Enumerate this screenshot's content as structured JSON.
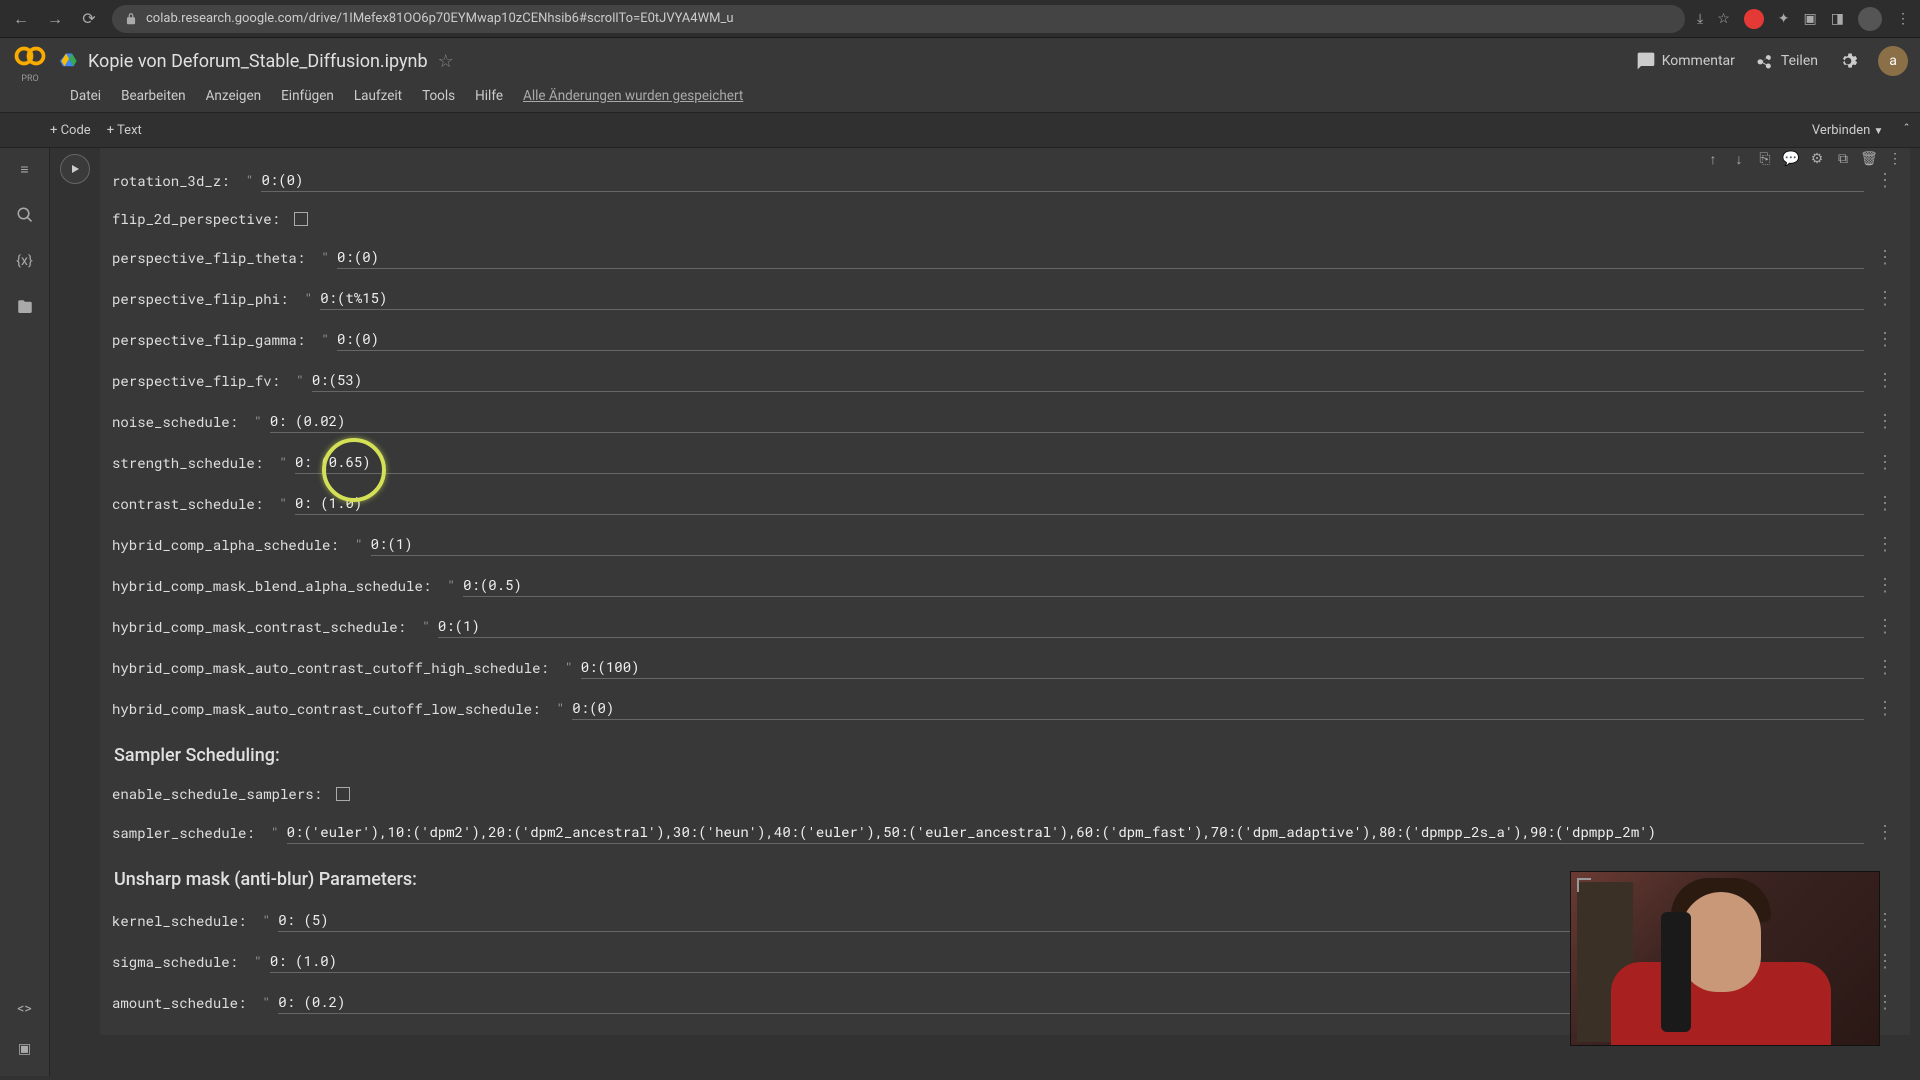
{
  "browser": {
    "url": "colab.research.google.com/drive/1IMefex81OO6p70EYMwap10zCENhsib6#scrollTo=E0tJVYA4WM_u"
  },
  "header": {
    "title": "Kopie von Deforum_Stable_Diffusion.ipynb",
    "pro": "PRO",
    "comment": "Kommentar",
    "share": "Teilen",
    "avatar_initial": "a"
  },
  "menus": {
    "file": "Datei",
    "edit": "Bearbeiten",
    "view": "Anzeigen",
    "insert": "Einfügen",
    "runtime": "Laufzeit",
    "tools": "Tools",
    "help": "Hilfe",
    "save_status": "Alle Änderungen wurden gespeichert"
  },
  "toolbar": {
    "code": "+ Code",
    "text": "+ Text",
    "connect": "Verbinden"
  },
  "sections": {
    "sampler": "Sampler Scheduling:",
    "unsharp": "Unsharp mask (anti-blur) Parameters:"
  },
  "params": [
    {
      "label": "rotation_3d_z:",
      "type": "text",
      "value": "0:(0)"
    },
    {
      "label": "flip_2d_perspective:",
      "type": "checkbox",
      "value": false
    },
    {
      "label": "perspective_flip_theta:",
      "type": "text",
      "value": "0:(0)"
    },
    {
      "label": "perspective_flip_phi:",
      "type": "text",
      "value": "0:(t%15)"
    },
    {
      "label": "perspective_flip_gamma:",
      "type": "text",
      "value": "0:(0)"
    },
    {
      "label": "perspective_flip_fv:",
      "type": "text",
      "value": "0:(53)"
    },
    {
      "label": "noise_schedule:",
      "type": "text",
      "value": "0: (0.02)"
    },
    {
      "label": "strength_schedule:",
      "type": "text",
      "value": "0: (0.65)"
    },
    {
      "label": "contrast_schedule:",
      "type": "text",
      "value": "0: (1.0)"
    },
    {
      "label": "hybrid_comp_alpha_schedule:",
      "type": "text",
      "value": "0:(1)"
    },
    {
      "label": "hybrid_comp_mask_blend_alpha_schedule:",
      "type": "text",
      "value": "0:(0.5)"
    },
    {
      "label": "hybrid_comp_mask_contrast_schedule:",
      "type": "text",
      "value": "0:(1)"
    },
    {
      "label": "hybrid_comp_mask_auto_contrast_cutoff_high_schedule:",
      "type": "text",
      "value": "0:(100)"
    },
    {
      "label": "hybrid_comp_mask_auto_contrast_cutoff_low_schedule:",
      "type": "text",
      "value": "0:(0)"
    }
  ],
  "sampler_params": [
    {
      "label": "enable_schedule_samplers:",
      "type": "checkbox",
      "value": false
    },
    {
      "label": "sampler_schedule:",
      "type": "text",
      "value": "0:('euler'),10:('dpm2'),20:('dpm2_ancestral'),30:('heun'),40:('euler'),50:('euler_ancestral'),60:('dpm_fast'),70:('dpm_adaptive'),80:('dpmpp_2s_a'),90:('dpmpp_2m')"
    }
  ],
  "unsharp_params": [
    {
      "label": "kernel_schedule:",
      "type": "text",
      "value": "0: (5)"
    },
    {
      "label": "sigma_schedule:",
      "type": "text",
      "value": "0: (1.0)"
    },
    {
      "label": "amount_schedule:",
      "type": "text",
      "value": "0: (0.2)"
    }
  ]
}
